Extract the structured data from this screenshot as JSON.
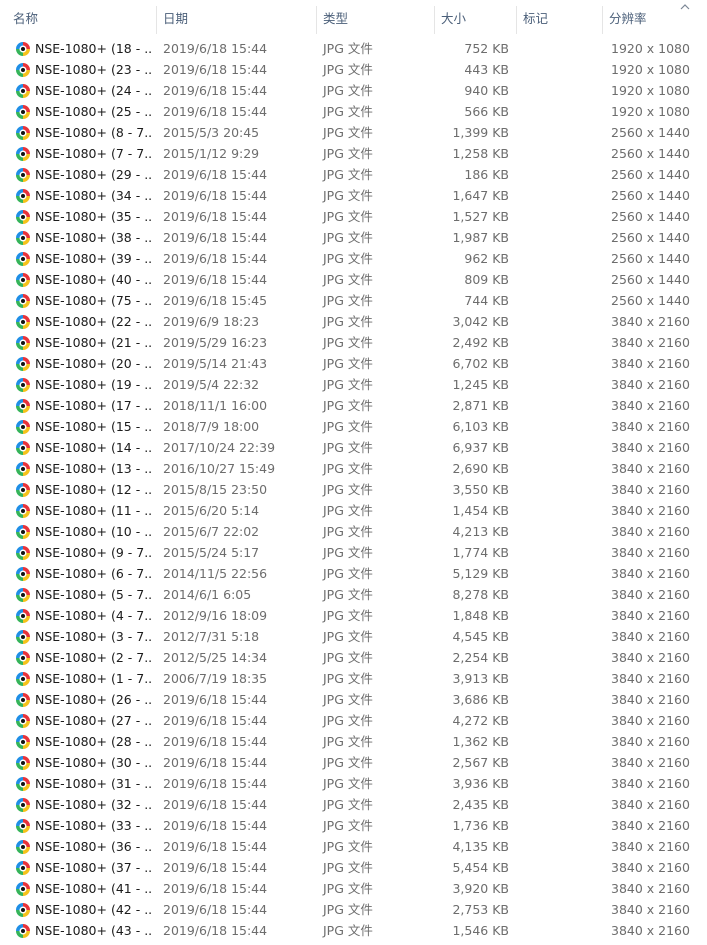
{
  "header": {
    "name": "名称",
    "date": "日期",
    "type": "类型",
    "size": "大小",
    "tags": "标记",
    "resolution": "分辨率"
  },
  "colors": {
    "header_text": "#4c607a",
    "secondary_text": "#6d6d6d",
    "icon_ring_red": "#e8333a",
    "icon_ring_blue": "#1f8fe6",
    "icon_ring_green": "#35b45a",
    "icon_ring_yellow": "#f5c21b"
  },
  "file_icon": "image-file-icon",
  "files": [
    {
      "name": "NSE-1080+ (18 - ...",
      "date": "2019/6/18 15:44",
      "type": "JPG 文件",
      "size": "752 KB",
      "resolution": "1920 x 1080"
    },
    {
      "name": "NSE-1080+ (23 - ...",
      "date": "2019/6/18 15:44",
      "type": "JPG 文件",
      "size": "443 KB",
      "resolution": "1920 x 1080"
    },
    {
      "name": "NSE-1080+ (24 - ...",
      "date": "2019/6/18 15:44",
      "type": "JPG 文件",
      "size": "940 KB",
      "resolution": "1920 x 1080"
    },
    {
      "name": "NSE-1080+ (25 - ...",
      "date": "2019/6/18 15:44",
      "type": "JPG 文件",
      "size": "566 KB",
      "resolution": "1920 x 1080"
    },
    {
      "name": "NSE-1080+ (8 - 7...",
      "date": "2015/5/3 20:45",
      "type": "JPG 文件",
      "size": "1,399 KB",
      "resolution": "2560 x 1440"
    },
    {
      "name": "NSE-1080+ (7 - 7...",
      "date": "2015/1/12 9:29",
      "type": "JPG 文件",
      "size": "1,258 KB",
      "resolution": "2560 x 1440"
    },
    {
      "name": "NSE-1080+ (29 - ...",
      "date": "2019/6/18 15:44",
      "type": "JPG 文件",
      "size": "186 KB",
      "resolution": "2560 x 1440"
    },
    {
      "name": "NSE-1080+ (34 - ...",
      "date": "2019/6/18 15:44",
      "type": "JPG 文件",
      "size": "1,647 KB",
      "resolution": "2560 x 1440"
    },
    {
      "name": "NSE-1080+ (35 - ...",
      "date": "2019/6/18 15:44",
      "type": "JPG 文件",
      "size": "1,527 KB",
      "resolution": "2560 x 1440"
    },
    {
      "name": "NSE-1080+ (38 - ...",
      "date": "2019/6/18 15:44",
      "type": "JPG 文件",
      "size": "1,987 KB",
      "resolution": "2560 x 1440"
    },
    {
      "name": "NSE-1080+ (39 - ...",
      "date": "2019/6/18 15:44",
      "type": "JPG 文件",
      "size": "962 KB",
      "resolution": "2560 x 1440"
    },
    {
      "name": "NSE-1080+ (40 - ...",
      "date": "2019/6/18 15:44",
      "type": "JPG 文件",
      "size": "809 KB",
      "resolution": "2560 x 1440"
    },
    {
      "name": "NSE-1080+ (75 - ...",
      "date": "2019/6/18 15:45",
      "type": "JPG 文件",
      "size": "744 KB",
      "resolution": "2560 x 1440"
    },
    {
      "name": "NSE-1080+ (22 - ...",
      "date": "2019/6/9 18:23",
      "type": "JPG 文件",
      "size": "3,042 KB",
      "resolution": "3840 x 2160"
    },
    {
      "name": "NSE-1080+ (21 - ...",
      "date": "2019/5/29 16:23",
      "type": "JPG 文件",
      "size": "2,492 KB",
      "resolution": "3840 x 2160"
    },
    {
      "name": "NSE-1080+ (20 - ...",
      "date": "2019/5/14 21:43",
      "type": "JPG 文件",
      "size": "6,702 KB",
      "resolution": "3840 x 2160"
    },
    {
      "name": "NSE-1080+ (19 - ...",
      "date": "2019/5/4 22:32",
      "type": "JPG 文件",
      "size": "1,245 KB",
      "resolution": "3840 x 2160"
    },
    {
      "name": "NSE-1080+ (17 - ...",
      "date": "2018/11/1 16:00",
      "type": "JPG 文件",
      "size": "2,871 KB",
      "resolution": "3840 x 2160"
    },
    {
      "name": "NSE-1080+ (15 - ...",
      "date": "2018/7/9 18:00",
      "type": "JPG 文件",
      "size": "6,103 KB",
      "resolution": "3840 x 2160"
    },
    {
      "name": "NSE-1080+ (14 - ...",
      "date": "2017/10/24 22:39",
      "type": "JPG 文件",
      "size": "6,937 KB",
      "resolution": "3840 x 2160"
    },
    {
      "name": "NSE-1080+ (13 - ...",
      "date": "2016/10/27 15:49",
      "type": "JPG 文件",
      "size": "2,690 KB",
      "resolution": "3840 x 2160"
    },
    {
      "name": "NSE-1080+ (12 - ...",
      "date": "2015/8/15 23:50",
      "type": "JPG 文件",
      "size": "3,550 KB",
      "resolution": "3840 x 2160"
    },
    {
      "name": "NSE-1080+ (11 - ...",
      "date": "2015/6/20 5:14",
      "type": "JPG 文件",
      "size": "1,454 KB",
      "resolution": "3840 x 2160"
    },
    {
      "name": "NSE-1080+ (10 - ...",
      "date": "2015/6/7 22:02",
      "type": "JPG 文件",
      "size": "4,213 KB",
      "resolution": "3840 x 2160"
    },
    {
      "name": "NSE-1080+ (9 - 7...",
      "date": "2015/5/24 5:17",
      "type": "JPG 文件",
      "size": "1,774 KB",
      "resolution": "3840 x 2160"
    },
    {
      "name": "NSE-1080+ (6 - 7...",
      "date": "2014/11/5 22:56",
      "type": "JPG 文件",
      "size": "5,129 KB",
      "resolution": "3840 x 2160"
    },
    {
      "name": "NSE-1080+ (5 - 7...",
      "date": "2014/6/1 6:05",
      "type": "JPG 文件",
      "size": "8,278 KB",
      "resolution": "3840 x 2160"
    },
    {
      "name": "NSE-1080+ (4 - 7...",
      "date": "2012/9/16 18:09",
      "type": "JPG 文件",
      "size": "1,848 KB",
      "resolution": "3840 x 2160"
    },
    {
      "name": "NSE-1080+ (3 - 7...",
      "date": "2012/7/31 5:18",
      "type": "JPG 文件",
      "size": "4,545 KB",
      "resolution": "3840 x 2160"
    },
    {
      "name": "NSE-1080+ (2 - 7...",
      "date": "2012/5/25 14:34",
      "type": "JPG 文件",
      "size": "2,254 KB",
      "resolution": "3840 x 2160"
    },
    {
      "name": "NSE-1080+ (1 - 7...",
      "date": "2006/7/19 18:35",
      "type": "JPG 文件",
      "size": "3,913 KB",
      "resolution": "3840 x 2160"
    },
    {
      "name": "NSE-1080+ (26 - ...",
      "date": "2019/6/18 15:44",
      "type": "JPG 文件",
      "size": "3,686 KB",
      "resolution": "3840 x 2160"
    },
    {
      "name": "NSE-1080+ (27 - ...",
      "date": "2019/6/18 15:44",
      "type": "JPG 文件",
      "size": "4,272 KB",
      "resolution": "3840 x 2160"
    },
    {
      "name": "NSE-1080+ (28 - ...",
      "date": "2019/6/18 15:44",
      "type": "JPG 文件",
      "size": "1,362 KB",
      "resolution": "3840 x 2160"
    },
    {
      "name": "NSE-1080+ (30 - ...",
      "date": "2019/6/18 15:44",
      "type": "JPG 文件",
      "size": "2,567 KB",
      "resolution": "3840 x 2160"
    },
    {
      "name": "NSE-1080+ (31 - ...",
      "date": "2019/6/18 15:44",
      "type": "JPG 文件",
      "size": "3,936 KB",
      "resolution": "3840 x 2160"
    },
    {
      "name": "NSE-1080+ (32 - ...",
      "date": "2019/6/18 15:44",
      "type": "JPG 文件",
      "size": "2,435 KB",
      "resolution": "3840 x 2160"
    },
    {
      "name": "NSE-1080+ (33 - ...",
      "date": "2019/6/18 15:44",
      "type": "JPG 文件",
      "size": "1,736 KB",
      "resolution": "3840 x 2160"
    },
    {
      "name": "NSE-1080+ (36 - ...",
      "date": "2019/6/18 15:44",
      "type": "JPG 文件",
      "size": "4,135 KB",
      "resolution": "3840 x 2160"
    },
    {
      "name": "NSE-1080+ (37 - ...",
      "date": "2019/6/18 15:44",
      "type": "JPG 文件",
      "size": "5,454 KB",
      "resolution": "3840 x 2160"
    },
    {
      "name": "NSE-1080+ (41 - ...",
      "date": "2019/6/18 15:44",
      "type": "JPG 文件",
      "size": "3,920 KB",
      "resolution": "3840 x 2160"
    },
    {
      "name": "NSE-1080+ (42 - ...",
      "date": "2019/6/18 15:44",
      "type": "JPG 文件",
      "size": "2,753 KB",
      "resolution": "3840 x 2160"
    },
    {
      "name": "NSE-1080+ (43 - ...",
      "date": "2019/6/18 15:44",
      "type": "JPG 文件",
      "size": "1,546 KB",
      "resolution": "3840 x 2160"
    }
  ]
}
